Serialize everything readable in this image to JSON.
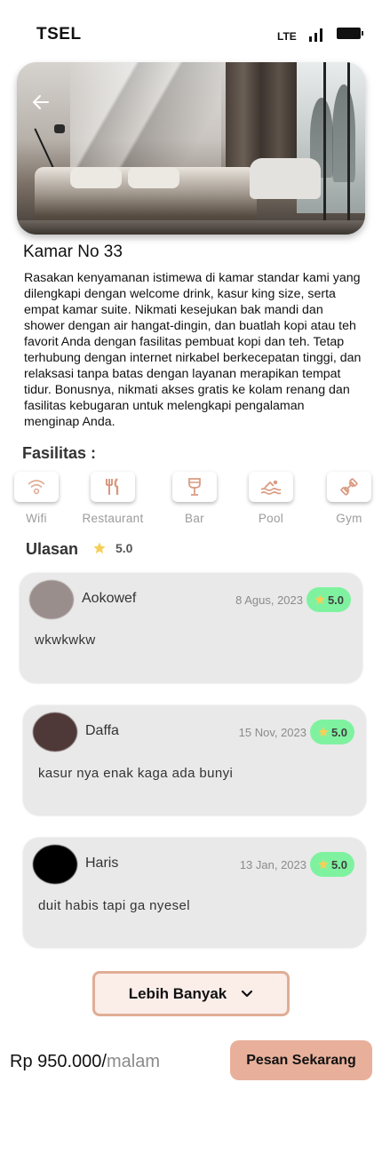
{
  "status_bar": {
    "carrier": "TSEL",
    "network": "LTE"
  },
  "hero": {
    "image_description": "luxury bedroom photo",
    "back_icon": "arrow-left-icon"
  },
  "room": {
    "title": "Kamar No 33",
    "description": "Rasakan kenyamanan istimewa di kamar standar kami yang dilengkapi dengan welcome drink, kasur king size, serta empat kamar suite. Nikmati kesejukan bak mandi dan shower dengan air hangat-dingin, dan buatlah kopi atau teh favorit Anda dengan fasilitas pembuat kopi dan teh. Tetap terhubung dengan internet nirkabel berkecepatan tinggi, dan relaksasi tanpa batas dengan layanan merapikan tempat tidur. Bonusnya, nikmati akses gratis ke kolam renang dan fasilitas kebugaran untuk melengkapi pengalaman menginap Anda."
  },
  "facilities": {
    "title": "Fasilitas :",
    "items": [
      {
        "label": "Wifi",
        "icon": "wifi-icon"
      },
      {
        "label": "Restaurant",
        "icon": "utensils-icon"
      },
      {
        "label": "Bar",
        "icon": "cocktail-glass-icon"
      },
      {
        "label": "Pool",
        "icon": "swimming-icon"
      },
      {
        "label": "Gym",
        "icon": "dumbbell-icon"
      }
    ]
  },
  "reviews": {
    "title": "Ulasan",
    "rating": "5.0",
    "items": [
      {
        "name": "Aokowef",
        "date": "8 Agus, 2023",
        "rating": "5.0",
        "text": "wkwkwkw",
        "avatar_color": "#9a8e8c"
      },
      {
        "name": "Daffa",
        "date": "15 Nov, 2023",
        "rating": "5.0",
        "text": "kasur nya enak kaga ada bunyi",
        "avatar_color": "#4f3838"
      },
      {
        "name": "Haris",
        "date": "13 Jan, 2023",
        "rating": "5.0",
        "text": "duit habis tapi ga nyesel",
        "avatar_color": "#000000"
      }
    ],
    "more_label": "Lebih Banyak"
  },
  "booking": {
    "price": "Rp 950.000/",
    "unit": "malam",
    "button_label": "Pesan Sekarang"
  },
  "colors": {
    "accent": "#e8b09b",
    "accent_border": "#e0ad96",
    "badge": "#7ff2a0",
    "star": "#f6cf57",
    "card": "#e9e9e9"
  }
}
